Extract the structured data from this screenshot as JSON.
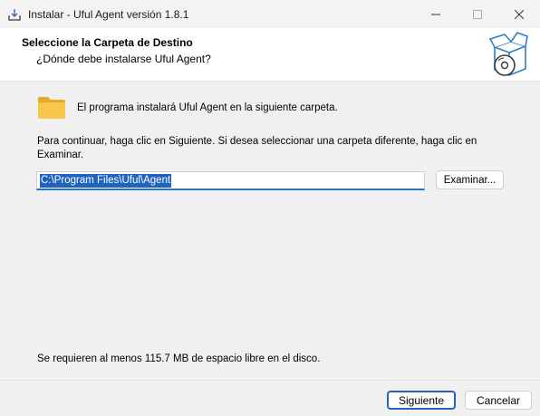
{
  "window": {
    "title": "Instalar - Uful Agent versión 1.8.1",
    "icon": "installer-icon",
    "controls": [
      "minimize-icon",
      "maximize-icon",
      "close-icon"
    ]
  },
  "header": {
    "title": "Seleccione la Carpeta de Destino",
    "subtitle": "¿Dónde debe instalarse Uful Agent?",
    "graphic": "box-with-disc-icon"
  },
  "body": {
    "intro": "El programa instalará Uful Agent en la siguiente carpeta.",
    "instructions": "Para continuar, haga clic en Siguiente. Si desea seleccionar una carpeta diferente, haga clic en Examinar.",
    "path_value": "C:\\Program Files\\Uful\\Agent",
    "browse_label": "Examinar...",
    "space_required": "Se requieren al menos 115.7 MB de espacio libre en el disco."
  },
  "footer": {
    "next_label": "Siguiente",
    "cancel_label": "Cancelar"
  },
  "colors": {
    "accent": "#1f66c4",
    "selection": "#1e63c2",
    "folder": "#f5c542"
  }
}
